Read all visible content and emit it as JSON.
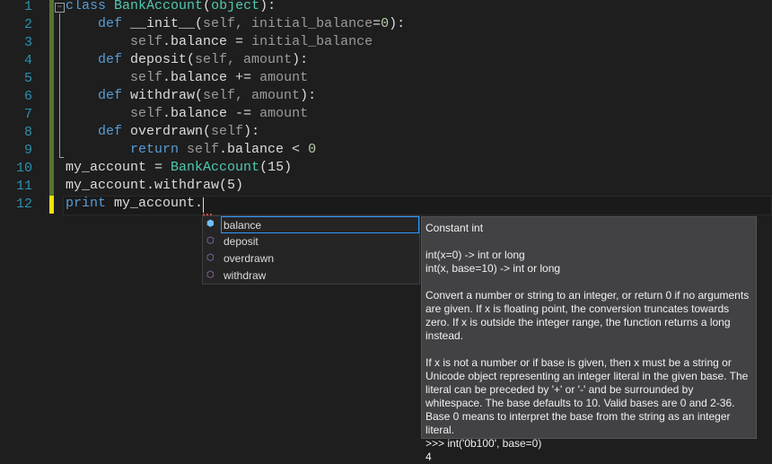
{
  "editor": {
    "line_numbers": [
      "1",
      "2",
      "3",
      "4",
      "5",
      "6",
      "7",
      "8",
      "9",
      "10",
      "11",
      "12"
    ],
    "lines": [
      [
        [
          "class ",
          "kw"
        ],
        [
          "BankAccount",
          "cls"
        ],
        [
          "(",
          "txt"
        ],
        [
          "object",
          "cls"
        ],
        [
          "):",
          "txt"
        ]
      ],
      [
        [
          "    def ",
          "kw"
        ],
        [
          "__init__",
          "txt"
        ],
        [
          "(",
          "txt"
        ],
        [
          "self, initial_balance",
          "self"
        ],
        [
          "=",
          "txt"
        ],
        [
          "0",
          "num"
        ],
        [
          "):",
          "txt"
        ]
      ],
      [
        [
          "        self",
          "self"
        ],
        [
          ".balance = ",
          "txt"
        ],
        [
          "initial_balance",
          "self"
        ]
      ],
      [
        [
          "    def ",
          "kw"
        ],
        [
          "deposit",
          "txt"
        ],
        [
          "(",
          "txt"
        ],
        [
          "self, amount",
          "self"
        ],
        [
          "):",
          "txt"
        ]
      ],
      [
        [
          "        self",
          "self"
        ],
        [
          ".balance += ",
          "txt"
        ],
        [
          "amount",
          "self"
        ]
      ],
      [
        [
          "    def ",
          "kw"
        ],
        [
          "withdraw",
          "txt"
        ],
        [
          "(",
          "txt"
        ],
        [
          "self, amount",
          "self"
        ],
        [
          "):",
          "txt"
        ]
      ],
      [
        [
          "        self",
          "self"
        ],
        [
          ".balance -= ",
          "txt"
        ],
        [
          "amount",
          "self"
        ]
      ],
      [
        [
          "    def ",
          "kw"
        ],
        [
          "overdrawn",
          "txt"
        ],
        [
          "(",
          "txt"
        ],
        [
          "self",
          "self"
        ],
        [
          "):",
          "txt"
        ]
      ],
      [
        [
          "        return ",
          "kw"
        ],
        [
          "self",
          "self"
        ],
        [
          ".balance < ",
          "txt"
        ],
        [
          "0",
          "num"
        ]
      ],
      [
        [
          "my_account = ",
          "txt"
        ],
        [
          "BankAccount",
          "cls"
        ],
        [
          "(15)",
          "txt"
        ]
      ],
      [
        [
          "my_account.withdraw(5)",
          "txt"
        ]
      ],
      [
        [
          "print ",
          "kw"
        ],
        [
          "my_account.",
          "txt"
        ]
      ]
    ],
    "fold_glyph": "−"
  },
  "completion": {
    "items": [
      {
        "label": "balance",
        "icon": "constant-icon",
        "glyph": "⬢",
        "selected": true
      },
      {
        "label": "deposit",
        "icon": "method-icon",
        "glyph": "⬡"
      },
      {
        "label": "overdrawn",
        "icon": "method-icon",
        "glyph": "⬡"
      },
      {
        "label": "withdraw",
        "icon": "method-icon",
        "glyph": "⬡"
      }
    ]
  },
  "tooltip": {
    "title": "Constant int",
    "sig1": "int(x=0) -> int or long",
    "sig2": "int(x, base=10) -> int or long",
    "para1": "Convert a number or string to an integer, or return 0 if no arguments are given.  If x is floating point, the conversion truncates towards zero. If x is outside the integer range, the function returns a long instead.",
    "para2": "If x is not a number or if base is given, then x must be a string or Unicode object representing an integer literal in the given base.  The literal can be preceded by '+' or '-' and be surrounded by whitespace. The base defaults to 10.  Valid bases are 0 and 2-36.  Base 0 means to interpret the base from the string as an integer literal.",
    "example": ">>> int('0b100', base=0)",
    "result": "4"
  }
}
